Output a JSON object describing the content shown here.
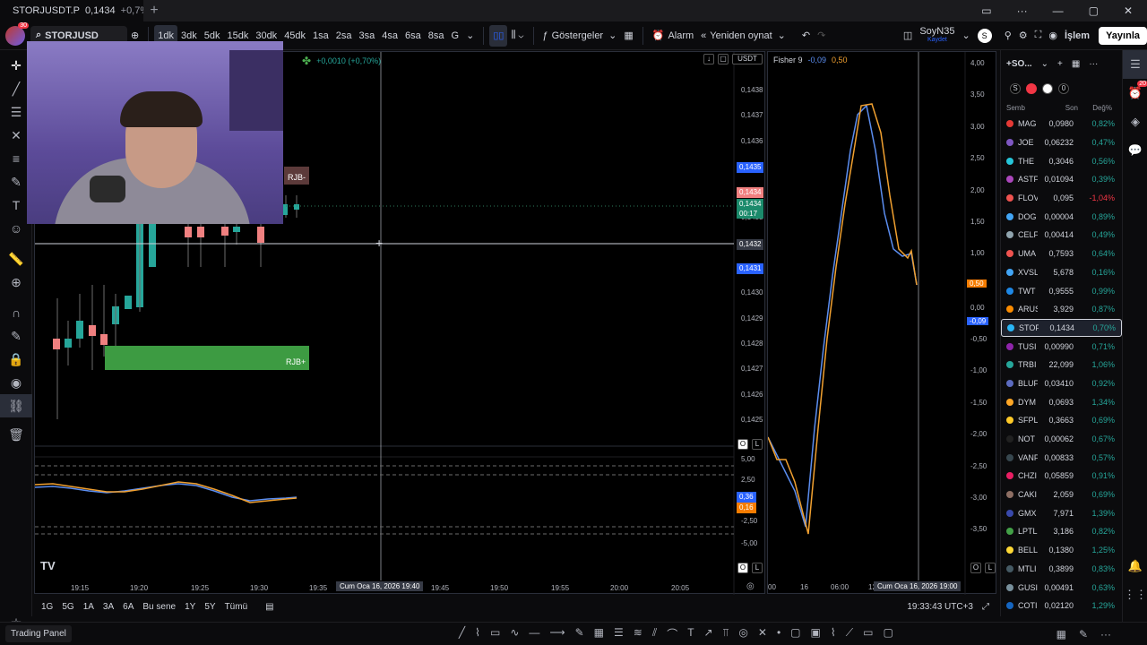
{
  "window": {
    "tab_title": "STORJUSDT.P",
    "tab_price": "0,1434",
    "tab_change": "+0,7%"
  },
  "toolbar": {
    "symbol": "STORJUSD",
    "intervals": [
      "1dk",
      "3dk",
      "5dk",
      "15dk",
      "30dk",
      "45dk",
      "1sa",
      "2sa",
      "3sa",
      "4sa",
      "6sa",
      "8sa",
      "G"
    ],
    "active_interval": "1dk",
    "indicators_label": "Göstergeler",
    "alarm_label": "Alarm",
    "replay_label": "Yeniden oynat",
    "layout_name": "SoyN35",
    "layout_sub": "Kaydet",
    "trade_label": "İşlem",
    "publish_label": "Yayınla",
    "user_initial": "S",
    "avatar_badge": "30"
  },
  "main_chart": {
    "change_label": "+0,0010 (+0,70%)",
    "currency_btn": "USDT",
    "rjb_top": "RJB-",
    "rjb_bottom": "RJB+",
    "price_ticks": [
      "0,1438",
      "0,1437",
      "0,1436",
      "0,1435",
      "0,1434",
      "0,1433",
      "0,1432",
      "0,1431",
      "0,1430",
      "0,1429",
      "0,1428",
      "0,1427",
      "0,1426",
      "0,1425"
    ],
    "tag_blue_top": "0,1435",
    "tag_red": "0,1434",
    "tag_green": "0,1434",
    "tag_green_timer": "00:17",
    "tag_crosshair": "0,1432",
    "tag_blue_low": "0,1431",
    "osc_ticks": [
      "5,00",
      "2,50",
      "-2,50",
      "-5,00"
    ],
    "osc_tag_blue": "0,36",
    "osc_tag_orange": "0,16",
    "time_ticks": [
      "19:15",
      "19:20",
      "19:25",
      "19:30",
      "19:35",
      "19:45",
      "19:50",
      "19:55",
      "20:00",
      "20:05"
    ],
    "time_crosshair": "Cum Oca 16, 2026  19:40",
    "ol_o": "O",
    "ol_l": "L"
  },
  "right_chart": {
    "title": "Fisher 9",
    "val1": "-0,09",
    "val2": "0,50",
    "y_ticks": [
      "4,00",
      "3,50",
      "3,00",
      "2,50",
      "2,00",
      "1,50",
      "1,00",
      "0,00",
      "-0,50",
      "-1,00",
      "-1,50",
      "-2,00",
      "-2,50",
      "-3,00",
      "-3,50"
    ],
    "tag_orange": "0,50",
    "tag_blue": "-0,09",
    "x_ticks": [
      "00",
      "16",
      "06:00",
      "12"
    ],
    "time_crosshair": "Cum Oca 16, 2026  19:00",
    "ol_o": "O",
    "ol_l": "L"
  },
  "watchlist": {
    "title": "+SO...",
    "headers": {
      "symbol": "Semb",
      "last": "Son",
      "change": "Değ%"
    },
    "filters": [
      "S",
      "",
      "",
      "0"
    ],
    "rows": [
      {
        "sym": "MAG",
        "last": "0,0980",
        "chg": "0,82%",
        "color": "#e53935",
        "neg": false
      },
      {
        "sym": "JOE",
        "last": "0,06232",
        "chg": "0,47%",
        "color": "#7e57c2",
        "neg": false
      },
      {
        "sym": "THE",
        "last": "0,3046",
        "chg": "0,56%",
        "color": "#26c6da",
        "neg": false
      },
      {
        "sym": "ASTF",
        "last": "0,01094",
        "chg": "0,39%",
        "color": "#ab47bc",
        "neg": false
      },
      {
        "sym": "FLOV",
        "last": "0,095",
        "chg": "-1,04%",
        "color": "#ef5350",
        "neg": true
      },
      {
        "sym": "DOG",
        "last": "0,00004",
        "chg": "0,89%",
        "color": "#42a5f5",
        "neg": false
      },
      {
        "sym": "CELF",
        "last": "0,00414",
        "chg": "0,49%",
        "color": "#90a4ae",
        "neg": false
      },
      {
        "sym": "UMA",
        "last": "0,7593",
        "chg": "0,64%",
        "color": "#ef5350",
        "neg": false
      },
      {
        "sym": "XVSL",
        "last": "5,678",
        "chg": "0,16%",
        "color": "#42a5f5",
        "neg": false
      },
      {
        "sym": "TWT",
        "last": "0,9555",
        "chg": "0,99%",
        "color": "#1e88e5",
        "neg": false
      },
      {
        "sym": "ARUS",
        "last": "3,929",
        "chg": "0,87%",
        "color": "#fb8c00",
        "neg": false
      },
      {
        "sym": "STOF",
        "last": "0,1434",
        "chg": "0,70%",
        "color": "#29b6f6",
        "neg": false,
        "selected": true
      },
      {
        "sym": "TUSI",
        "last": "0,00990",
        "chg": "0,71%",
        "color": "#8e24aa",
        "neg": false
      },
      {
        "sym": "TRBI",
        "last": "22,099",
        "chg": "1,06%",
        "color": "#26a69a",
        "neg": false
      },
      {
        "sym": "BLUF",
        "last": "0,03410",
        "chg": "0,92%",
        "color": "#5c6bc0",
        "neg": false
      },
      {
        "sym": "DYM",
        "last": "0,0693",
        "chg": "1,34%",
        "color": "#ffa726",
        "neg": false
      },
      {
        "sym": "SFPL",
        "last": "0,3663",
        "chg": "0,69%",
        "color": "#ffca28",
        "neg": false
      },
      {
        "sym": "NOT",
        "last": "0,00062",
        "chg": "0,67%",
        "color": "#212121",
        "neg": false
      },
      {
        "sym": "VANF",
        "last": "0,00833",
        "chg": "0,57%",
        "color": "#37474f",
        "neg": false
      },
      {
        "sym": "CHZI",
        "last": "0,05859",
        "chg": "0,91%",
        "color": "#e91e63",
        "neg": false
      },
      {
        "sym": "CAKI",
        "last": "2,059",
        "chg": "0,69%",
        "color": "#8d6e63",
        "neg": false
      },
      {
        "sym": "GMX",
        "last": "7,971",
        "chg": "1,39%",
        "color": "#3949ab",
        "neg": false
      },
      {
        "sym": "LPTL",
        "last": "3,186",
        "chg": "0,82%",
        "color": "#43a047",
        "neg": false
      },
      {
        "sym": "BELL",
        "last": "0,1380",
        "chg": "1,25%",
        "color": "#fdd835",
        "neg": false
      },
      {
        "sym": "MTLI",
        "last": "0,3899",
        "chg": "0,83%",
        "color": "#455a64",
        "neg": false
      },
      {
        "sym": "GUSI",
        "last": "0,00491",
        "chg": "0,63%",
        "color": "#78909c",
        "neg": false
      },
      {
        "sym": "COTI",
        "last": "0,02120",
        "chg": "1,29%",
        "color": "#1565c0",
        "neg": false
      }
    ]
  },
  "rail": {
    "notif_badge": "20"
  },
  "bottom": {
    "ranges": [
      "1G",
      "5G",
      "1A",
      "3A",
      "6A",
      "Bu sene",
      "1Y",
      "5Y",
      "Tümü"
    ],
    "clock": "19:33:43 UTC+3"
  },
  "panel": {
    "label": "Trading Panel",
    "wl_footer": "S."
  }
}
